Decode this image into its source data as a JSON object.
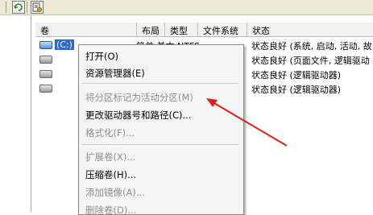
{
  "toolbar": {
    "refresh_icon": "refresh-icon",
    "properties_icon": "properties-icon"
  },
  "table": {
    "columns": [
      "卷",
      "布局",
      "类型",
      "文件系统",
      "状态"
    ],
    "rows": [
      {
        "volume": "(C:)",
        "status": "状态良好 (系统, 启动, 活动, 故"
      },
      {
        "volume": "",
        "status": "状态良好 (页面文件, 逻辑驱动"
      },
      {
        "volume": "",
        "status": "状态良好 (逻辑驱动器)"
      },
      {
        "volume": "",
        "status": "状态良好 (逻辑驱动器)"
      }
    ],
    "row0_partial": "简单   基本   NTFS"
  },
  "context_menu": {
    "items": [
      {
        "label": "打开(O)",
        "disabled": false
      },
      {
        "label": "资源管理器(E)",
        "disabled": false
      },
      {
        "label": "将分区标记为活动分区(M)",
        "disabled": true
      },
      {
        "label": "更改驱动器号和路径(C)...",
        "disabled": false
      },
      {
        "label": "格式化(F)...",
        "disabled": true
      },
      {
        "label": "扩展卷(X)...",
        "disabled": true
      },
      {
        "label": "压缩卷(H)...",
        "disabled": false
      },
      {
        "label": "添加镜像(A)...",
        "disabled": true
      },
      {
        "label": "删除卷(D)...",
        "disabled": true
      }
    ]
  },
  "annotation": {
    "color": "#e0201c"
  }
}
